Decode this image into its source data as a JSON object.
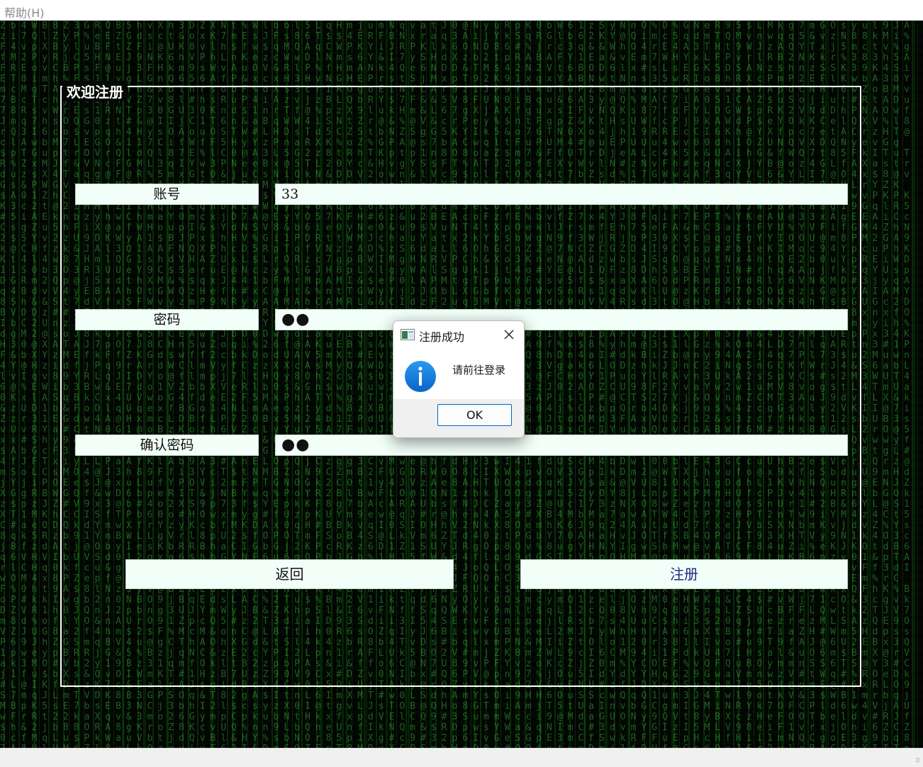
{
  "menubar": {
    "help_label": "帮助(H)"
  },
  "form": {
    "group_title": "欢迎注册",
    "account_label": "账号",
    "account_value": "33",
    "password_label": "密码",
    "password_value": "●●",
    "confirm_label": "确认密码",
    "confirm_value": "●●",
    "back_button": "返回",
    "register_button": "注册"
  },
  "dialog": {
    "title": "注册成功",
    "message": "请前往登录",
    "ok_label": "OK",
    "icon": "info-icon",
    "accent_color": "#0067c0"
  },
  "colors": {
    "background": "#020a03",
    "matrix_green": "#46c846",
    "field_fill": "#f2fff8",
    "register_text": "#1f2a80"
  }
}
